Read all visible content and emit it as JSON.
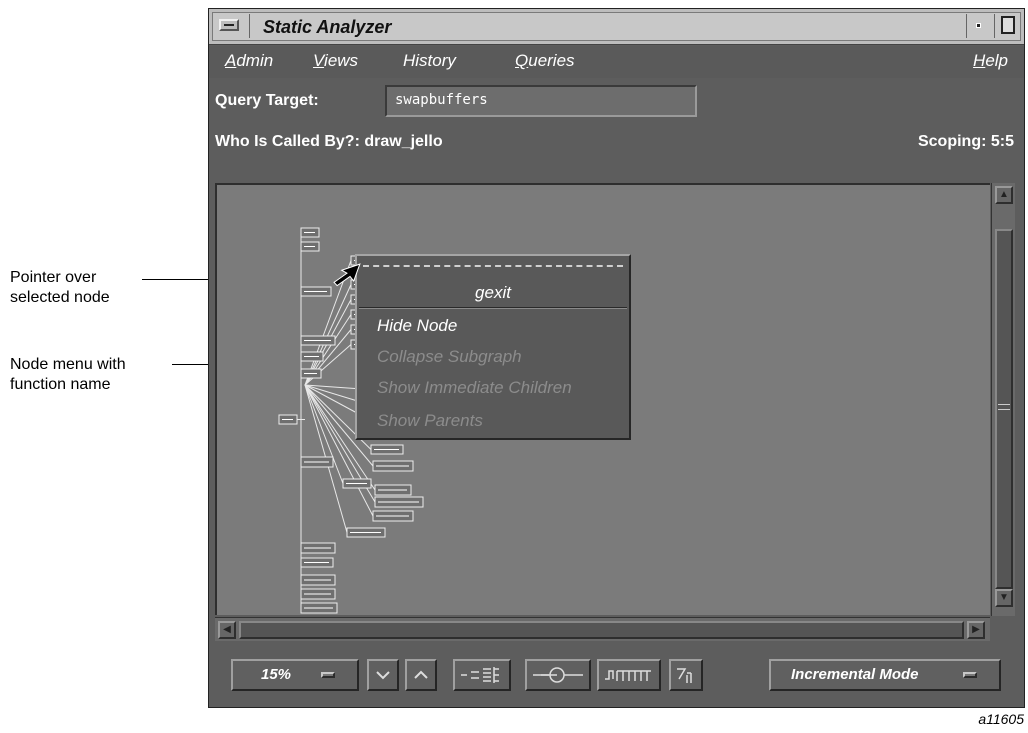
{
  "window": {
    "title": "Static Analyzer"
  },
  "menubar": {
    "admin": "Admin",
    "views": "Views",
    "history": "History",
    "queries": "Queries",
    "help": "Help"
  },
  "query": {
    "target_label": "Query Target:",
    "target_value": "swapbuffers"
  },
  "status": {
    "called_by": "Who Is Called By?: draw_jello",
    "scoping": "Scoping: 5:5"
  },
  "node_menu": {
    "title": "gexit",
    "items": [
      {
        "label": "Hide Node",
        "enabled": true
      },
      {
        "label": "Collapse Subgraph",
        "enabled": false
      },
      {
        "label": "Show Immediate Children",
        "enabled": false
      },
      {
        "label": "Show Parents",
        "enabled": false
      }
    ]
  },
  "toolbar": {
    "zoom": "15%",
    "mode": "Incremental Mode"
  },
  "callouts": {
    "pointer": "Pointer over\nselected node",
    "node_menu": "Node menu with\nfunction name"
  },
  "figure_id": "a11605"
}
